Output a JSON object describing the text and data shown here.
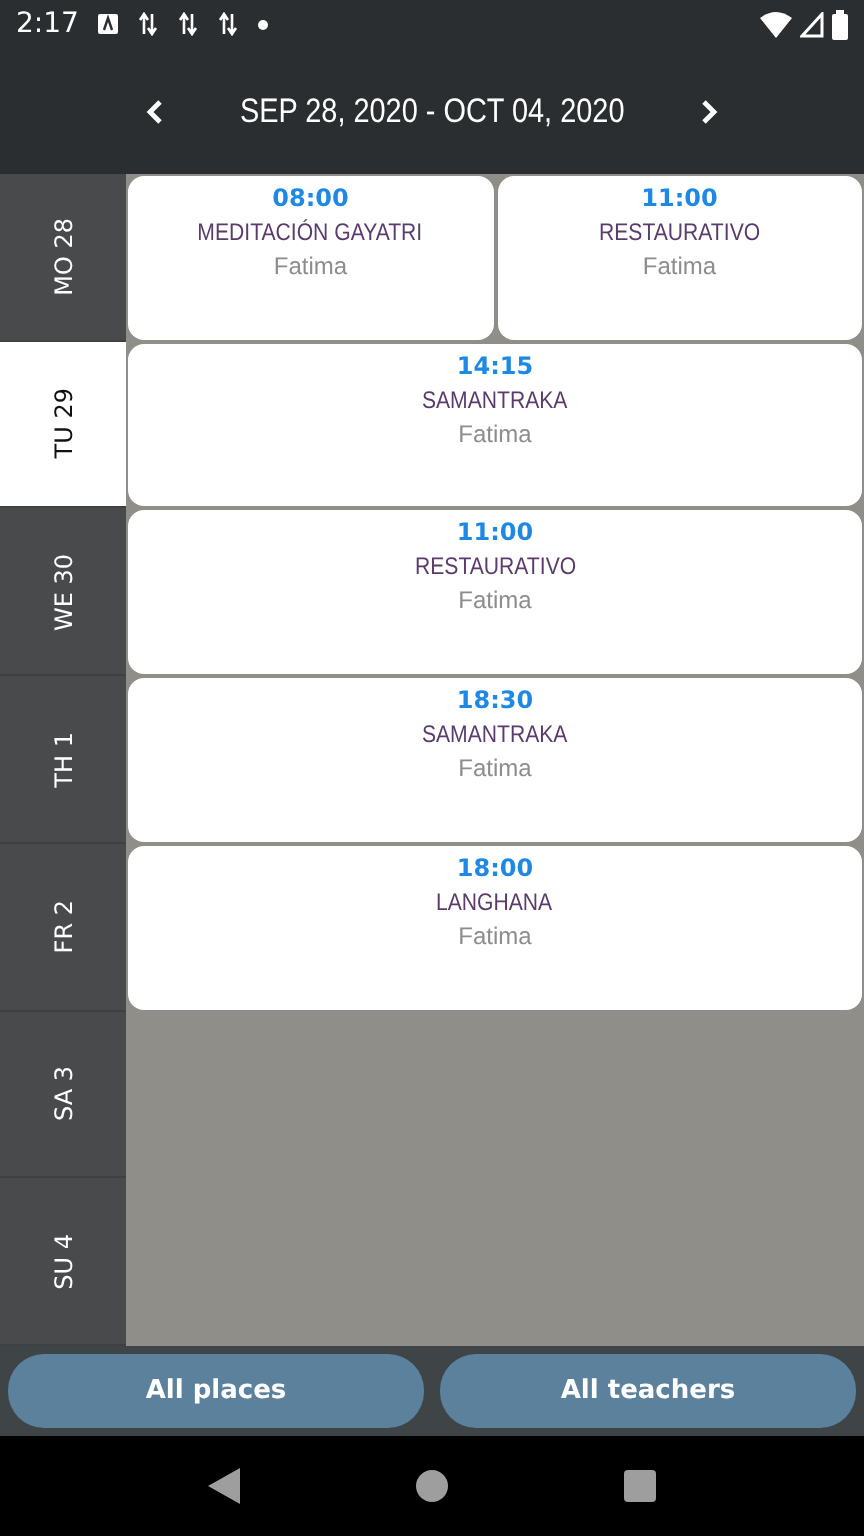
{
  "status_bar": {
    "time": "2:17"
  },
  "header": {
    "range": "SEP 28, 2020 - OCT 04, 2020"
  },
  "days": [
    {
      "label": "MO 28",
      "selected": false,
      "sessions": [
        {
          "time": "08:00",
          "title": "MEDITACIÓN GAYATRI",
          "teacher": "Fatima"
        },
        {
          "time": "11:00",
          "title": "RESTAURATIVO",
          "teacher": "Fatima"
        }
      ]
    },
    {
      "label": "TU 29",
      "selected": true,
      "sessions": [
        {
          "time": "14:15",
          "title": "SAMANTRAKA",
          "teacher": "Fatima"
        }
      ]
    },
    {
      "label": "WE 30",
      "selected": false,
      "sessions": [
        {
          "time": "11:00",
          "title": "RESTAURATIVO",
          "teacher": "Fatima"
        }
      ]
    },
    {
      "label": "TH 1",
      "selected": false,
      "sessions": [
        {
          "time": "18:30",
          "title": "SAMANTRAKA",
          "teacher": "Fatima"
        }
      ]
    },
    {
      "label": "FR 2",
      "selected": false,
      "sessions": [
        {
          "time": "18:00",
          "title": "LANGHANA",
          "teacher": "Fatima"
        }
      ]
    },
    {
      "label": "SA 3",
      "selected": false
    },
    {
      "label": "SU 4",
      "selected": false
    }
  ],
  "buttons": [
    "All places",
    "All teachers"
  ]
}
